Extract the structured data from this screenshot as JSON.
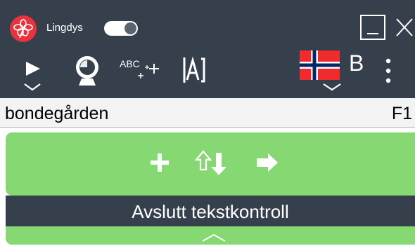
{
  "header": {
    "app_name": "Lingdys",
    "logo_icon": "flower-logo-icon",
    "toggle_on": true
  },
  "toolbar": {
    "play_icon": "play-icon",
    "globe_icon": "globe-lamp-icon",
    "spell_icon": "abc-sparkle-icon",
    "read_icon": "text-reader-icon",
    "language_flag": "norway-flag-icon",
    "language_variant": "B",
    "more_icon": "kebab-menu-icon"
  },
  "word_bar": {
    "word": "bondegården",
    "shortcut": "F1"
  },
  "actions": {
    "add_icon": "plus-icon",
    "sort_icon": "shift-down-arrow-icon",
    "next_icon": "arrow-right-icon"
  },
  "footer": {
    "exit_label": "Avslutt tekstkontroll"
  },
  "colors": {
    "toolbar_bg": "#36404d",
    "accent_green": "#86d872",
    "logo_red": "#e8323c"
  }
}
